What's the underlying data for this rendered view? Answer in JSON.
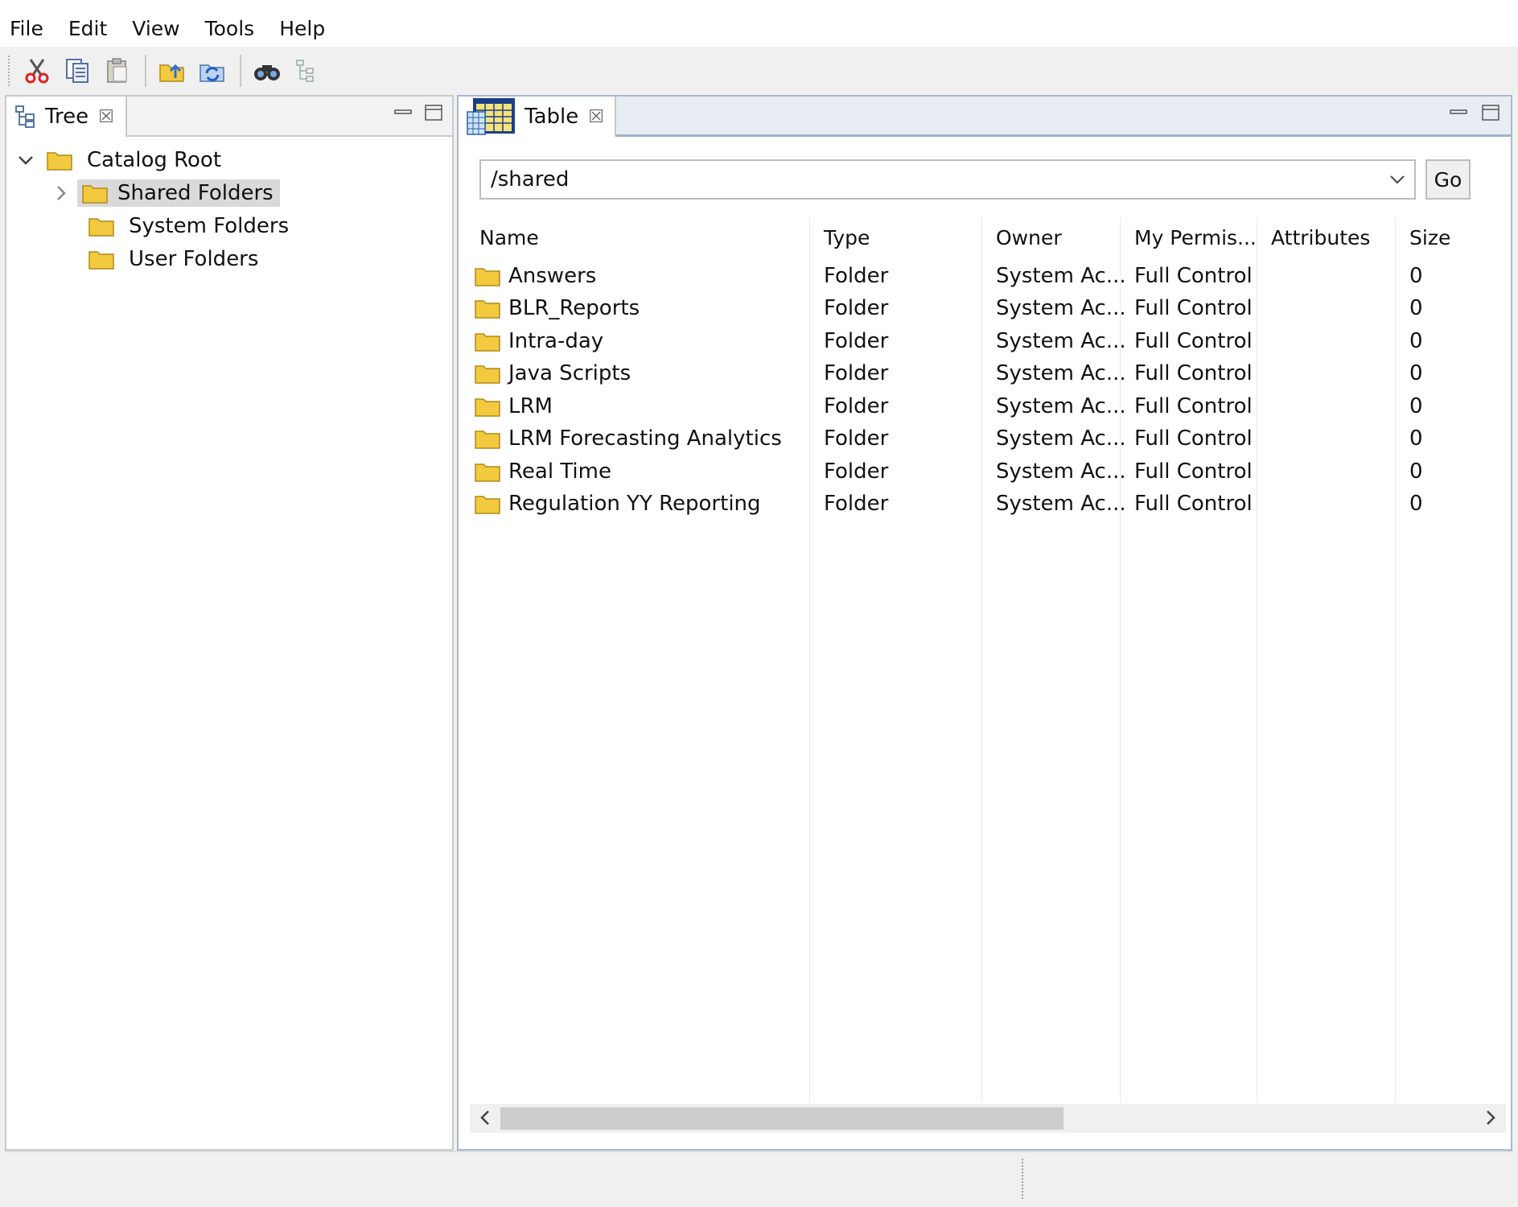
{
  "menu": [
    "File",
    "Edit",
    "View",
    "Tools",
    "Help"
  ],
  "toolbar": {
    "icons": [
      "cut-icon",
      "copy-icon",
      "paste-icon",
      "upload-folder-icon",
      "refresh-icon",
      "find-icon",
      "tree-view-icon"
    ]
  },
  "left_panel": {
    "tab_label": "Tree",
    "tree": {
      "root": "Catalog Root",
      "children": [
        "Shared Folders",
        "System Folders",
        "User Folders"
      ]
    }
  },
  "right_panel": {
    "tab_label": "Table",
    "path": "/shared",
    "go_label": "Go",
    "columns": [
      "Name",
      "Type",
      "Owner",
      "My Permis...",
      "Attributes",
      "Size"
    ],
    "rows": [
      {
        "name": "Answers",
        "type": "Folder",
        "owner": "System Ac...",
        "perm": "Full Control",
        "attr": "",
        "size": "0"
      },
      {
        "name": "BLR_Reports",
        "type": "Folder",
        "owner": "System Ac...",
        "perm": "Full Control",
        "attr": "",
        "size": "0"
      },
      {
        "name": "Intra-day",
        "type": "Folder",
        "owner": "System Ac...",
        "perm": "Full Control",
        "attr": "",
        "size": "0"
      },
      {
        "name": "Java Scripts",
        "type": "Folder",
        "owner": "System Ac...",
        "perm": "Full Control",
        "attr": "",
        "size": "0"
      },
      {
        "name": "LRM",
        "type": "Folder",
        "owner": "System Ac...",
        "perm": "Full Control",
        "attr": "",
        "size": "0"
      },
      {
        "name": "LRM Forecasting Analytics",
        "type": "Folder",
        "owner": "System Ac...",
        "perm": "Full Control",
        "attr": "",
        "size": "0"
      },
      {
        "name": "Real Time",
        "type": "Folder",
        "owner": "System Ac...",
        "perm": "Full Control",
        "attr": "",
        "size": "0"
      },
      {
        "name": "Regulation YY Reporting",
        "type": "Folder",
        "owner": "System Ac...",
        "perm": "Full Control",
        "attr": "",
        "size": "0"
      }
    ]
  },
  "colors": {
    "folder": "#f3c93f",
    "selection": "#d9d9d9",
    "tab_active_border": "#9fb4cf"
  }
}
